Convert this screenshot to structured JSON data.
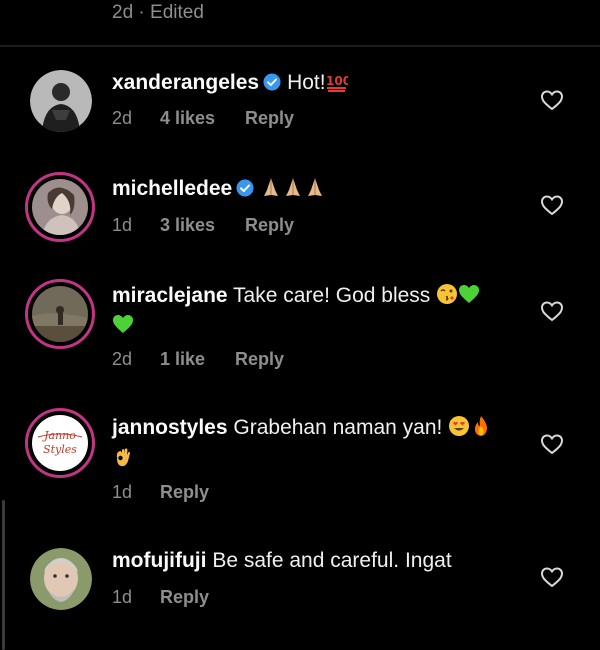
{
  "header": {
    "meta": "2d · Edited"
  },
  "comments": [
    {
      "username": "xanderangeles",
      "verified": true,
      "text": "Hot!",
      "emojis": [
        "hundred-points-emoji"
      ],
      "time": "2d",
      "likes": "4 likes",
      "reply": "Reply"
    },
    {
      "username": "michelledee",
      "verified": true,
      "text": "",
      "emojis": [
        "folded-hands-emoji",
        "folded-hands-emoji",
        "folded-hands-emoji"
      ],
      "time": "1d",
      "likes": "3 likes",
      "reply": "Reply"
    },
    {
      "username": "miraclejane",
      "verified": false,
      "text": "Take care! God bless",
      "emojis": [
        "kissing-face-emoji",
        "green-heart-emoji",
        "green-heart-emoji"
      ],
      "time": "2d",
      "likes": "1 like",
      "reply": "Reply"
    },
    {
      "username": "jannostyles",
      "verified": false,
      "text": "Grabehan naman yan!",
      "emojis": [
        "heart-eyes-emoji",
        "fire-emoji",
        "ok-hand-emoji"
      ],
      "time": "1d",
      "likes": "",
      "reply": "Reply",
      "avatar_text": "Janno Styles"
    },
    {
      "username": "mofujifuji",
      "verified": false,
      "text": "Be safe and careful.  Ingat",
      "emojis": [],
      "time": "1d",
      "likes": "",
      "reply": "Reply"
    }
  ],
  "colors": {
    "background": "#000000",
    "username": "#fafafa",
    "secondary": "#8e8e8e",
    "verified": "#3897f0",
    "story_ring": "#c13584"
  }
}
